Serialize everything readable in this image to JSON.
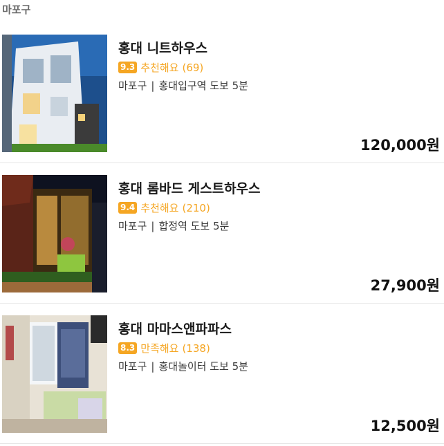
{
  "region_label": "마포구",
  "listings": [
    {
      "name": "홍대 니트하우스",
      "score": "9.3",
      "rating_text": "추천해요",
      "review_count": "(69)",
      "district": "마포구",
      "distance": "홍대입구역 도보 5분",
      "price": "120,000원"
    },
    {
      "name": "홍대 롬바드 게스트하우스",
      "score": "9.4",
      "rating_text": "추천해요",
      "review_count": "(210)",
      "district": "마포구",
      "distance": "합정역 도보 5분",
      "price": "27,900원"
    },
    {
      "name": "홍대 마마스앤파파스",
      "score": "8.3",
      "rating_text": "만족해요",
      "review_count": "(138)",
      "district": "마포구",
      "distance": "홍대놀이터 도보 5분",
      "price": "12,500원"
    }
  ],
  "colors": {
    "accent": "#f5a623",
    "divider": "#e6e6e6",
    "region_label": "#6b6b6b"
  }
}
